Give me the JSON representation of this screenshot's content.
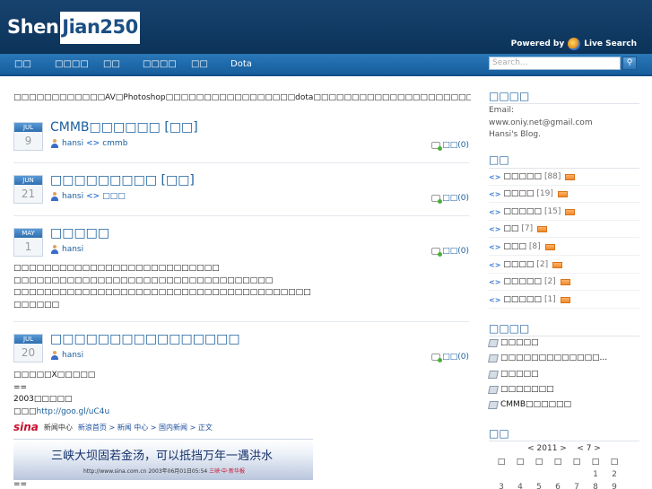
{
  "header": {
    "logo_part1": "Shen",
    "logo_part2": "Jian250",
    "powered_by": "Powered  by",
    "live_search": "Live Search"
  },
  "nav": {
    "items": [
      "□□",
      "□□□□",
      "□□",
      "□□□□",
      "□□",
      "Dota"
    ]
  },
  "search": {
    "placeholder": "Search..."
  },
  "intro": "□□□□□□□□□□□□AV□Photoshop□□□□□□□□□□□□□□□□□dota□□□□□□□□□□□□□□□□□□□□□□□□□",
  "posts": [
    {
      "month": "JUL",
      "day": "9",
      "title": "CMMB□□□□□□ [□□]",
      "author": "hansi",
      "category": "cmmb",
      "comments": "□□(0)"
    },
    {
      "month": "JUN",
      "day": "21",
      "title": "□□□□□□□□□ [□□]",
      "author": "hansi",
      "category": "□□□",
      "comments": "□□(0)"
    },
    {
      "month": "MAY",
      "day": "1",
      "title": "□□□□□",
      "author": "hansi",
      "category": "",
      "comments": "□□(0)",
      "body": [
        "□□□□□□□□□□□□□□□□□□□□□□□□□□□",
        "□□□□□□□□□□□□□□□□□□□□□□□□□□□□□□□□□□",
        "□□□□□□□□□□□□□□□□□□□□□□□□□□□□□□□□□□□□□□□",
        "□□□□□□"
      ]
    },
    {
      "month": "JUL",
      "day": "20",
      "title": "□□□□□□□□□□□□□□□□",
      "author": "hansi",
      "category": "",
      "comments": "□□(0)",
      "body": [
        "□□□□□X□□□□□",
        "==",
        "2003□□□□□"
      ],
      "link_prefix": "□□□",
      "link": "http://goo.gl/uC4u",
      "after": "=="
    }
  ],
  "news_image": {
    "brand": "sina",
    "center": "新闻中心",
    "crumbs": "新浪首页 > 新闻 中心 > 国内新闻 > 正文",
    "headline": "三峡大坝固若金汤，可以抵挡万年一遇洪水",
    "url": "http://www.sina.com.cn 2003年06月01日05:54",
    "source": "三峡·中·新华报"
  },
  "sidebar": {
    "about_title": "□□□□",
    "email": "Email:",
    "email_addr": "www.oniy.net@gmail.com",
    "blog": "Hansi's Blog.",
    "categories_title": "□□",
    "categories": [
      {
        "name": "□□□□□",
        "count": "[88]"
      },
      {
        "name": "□□□□",
        "count": "[19]"
      },
      {
        "name": "□□□□□",
        "count": "[15]"
      },
      {
        "name": "□□",
        "count": "[7]"
      },
      {
        "name": "□□□",
        "count": "[8]"
      },
      {
        "name": "□□□□",
        "count": "[2]"
      },
      {
        "name": "□□□□□",
        "count": "[2]"
      },
      {
        "name": "□□□□□",
        "count": "[1]"
      }
    ],
    "recent_title": "□□□□",
    "recent": [
      "□□□□□",
      "□□□□□□□□□□□□□...",
      "□□□□□",
      "□□□□□□□",
      "CMMB□□□□□□"
    ],
    "calendar_title": "□□",
    "calendar": {
      "year_nav": "< 2011 >",
      "month_nav": "< 7 >",
      "dow": [
        "□",
        "□",
        "□",
        "□",
        "□",
        "□",
        "□"
      ],
      "row1": [
        "",
        "",
        "",
        "",
        "",
        "1",
        "2"
      ],
      "row2": [
        "3",
        "4",
        "5",
        "6",
        "7",
        "8",
        "9"
      ]
    }
  }
}
